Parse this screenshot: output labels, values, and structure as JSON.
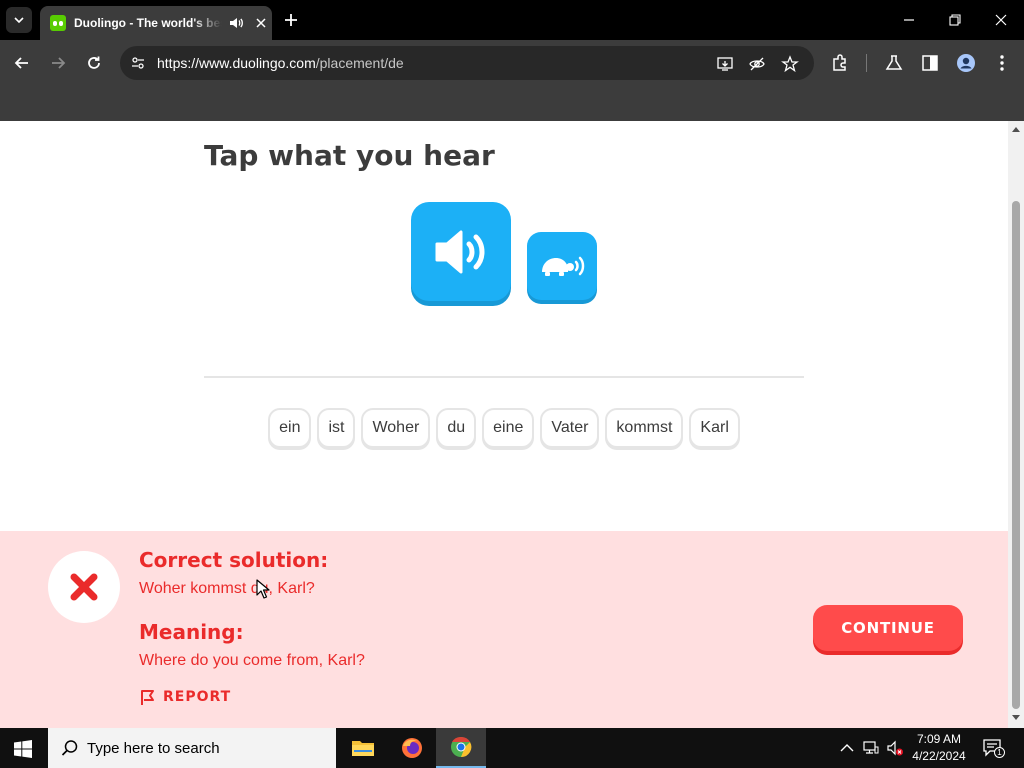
{
  "browser": {
    "tab_title": "Duolingo - The world's best way to learn a language",
    "url_host": "https://www.duolingo.com",
    "url_path": "/placement/de"
  },
  "lesson": {
    "prompt": "Tap what you hear",
    "word_bank": [
      "ein",
      "ist",
      "Woher",
      "du",
      "eine",
      "Vater",
      "kommst",
      "Karl"
    ]
  },
  "feedback": {
    "status": "incorrect",
    "correct_heading": "Correct solution:",
    "correct_text": "Woher kommst du, Karl?",
    "meaning_heading": "Meaning:",
    "meaning_text": "Where do you come from, Karl?",
    "report_label": "REPORT",
    "continue_label": "CONTINUE"
  },
  "taskbar": {
    "search_placeholder": "Type here to search",
    "time": "7:09 AM",
    "date": "4/22/2024",
    "notification_count": "1"
  },
  "colors": {
    "accent_blue": "#1cb0f6",
    "error_red": "#ea2b2b",
    "feedback_bg": "#ffdfe0",
    "continue_red": "#ff4b4b"
  }
}
